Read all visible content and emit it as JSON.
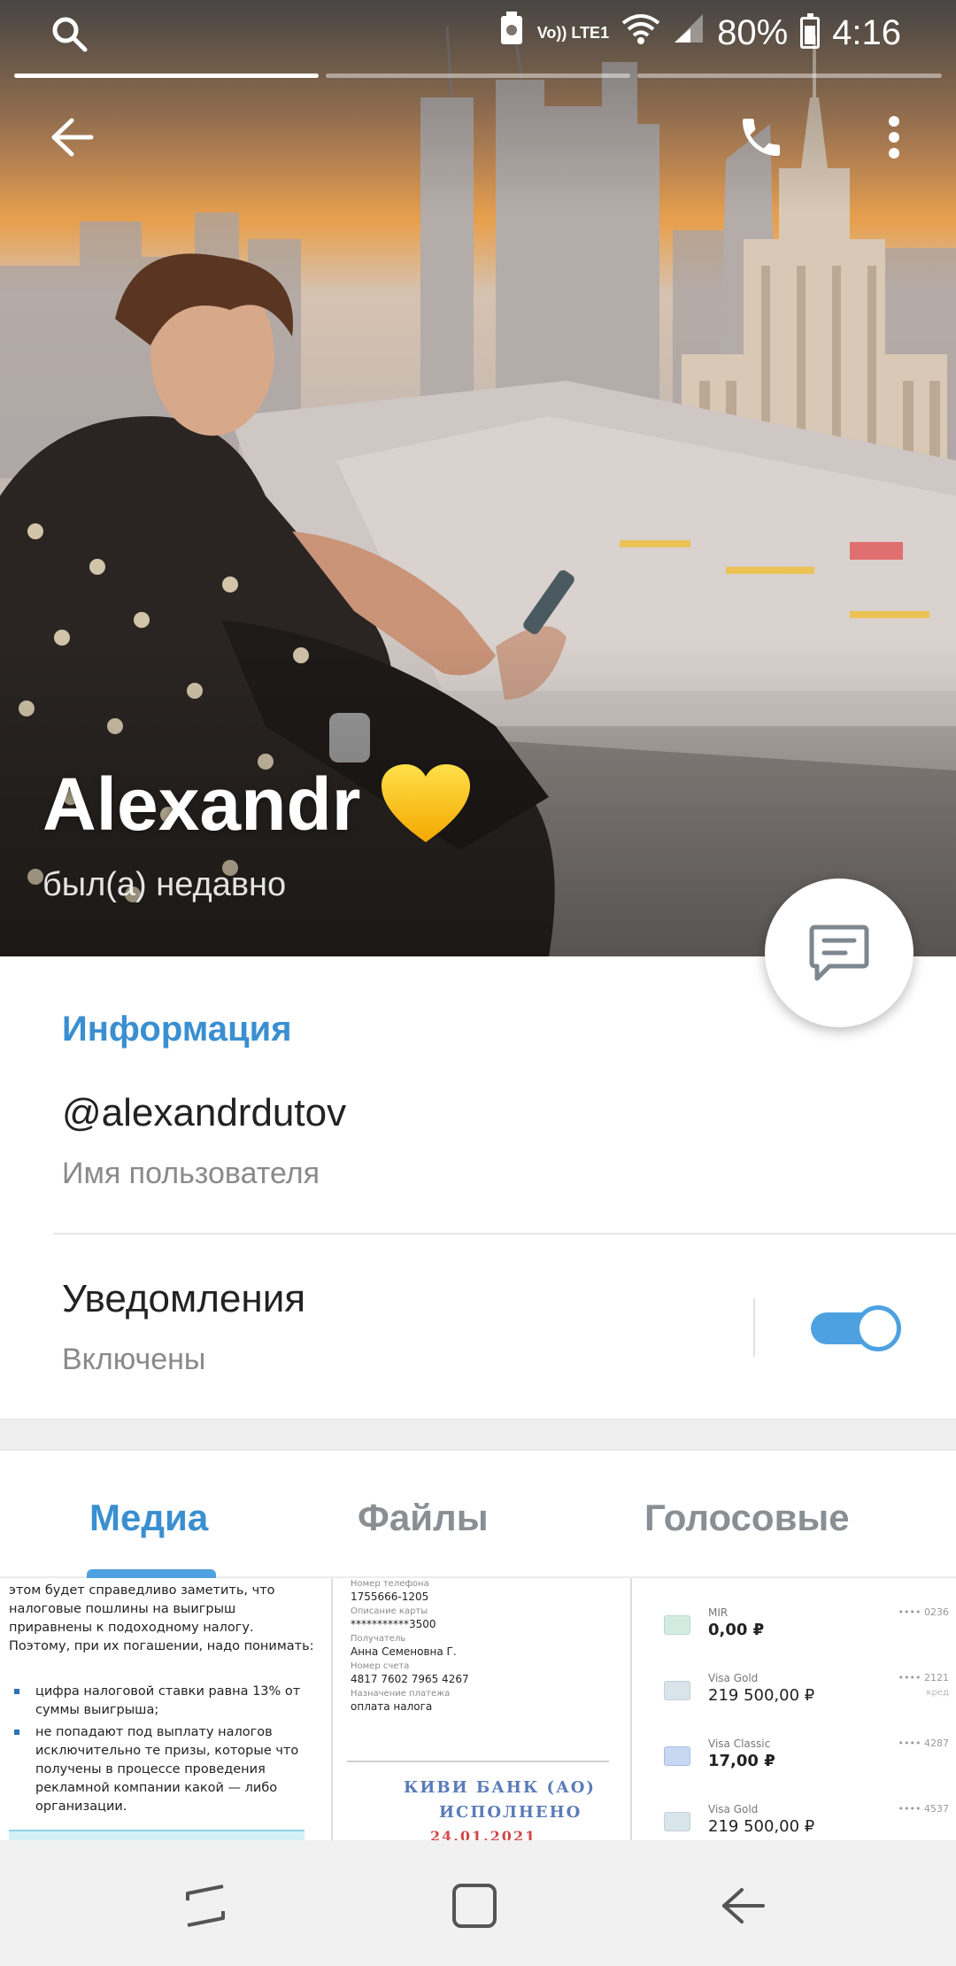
{
  "status_bar": {
    "network": "Vo)) LTE1",
    "battery": "80%",
    "time": "4:16"
  },
  "profile": {
    "name": "Alexandr",
    "name_emoji": "yellow-heart",
    "last_seen": "был(а) недавно"
  },
  "info": {
    "section_title": "Информация",
    "username": "@alexandrdutov",
    "username_label": "Имя пользователя",
    "notifications_title": "Уведомления",
    "notifications_status": "Включены",
    "notifications_enabled": true
  },
  "tabs": [
    {
      "label": "Медиа",
      "active": true
    },
    {
      "label": "Файлы",
      "active": false
    },
    {
      "label": "Голосовые",
      "active": false
    }
  ],
  "media": {
    "doc_paragraph": "этом будет справедливо заметить, что налоговые пошлины на выигрыш приравнены к подоходному налогу. Поэтому, при их погашении, надо понимать:",
    "doc_bullets": [
      "цифра налоговой ставки равна 13% от суммы выигрыша;",
      "не попадают под выплату налогов исключительно те призы, которые что получены в процессе проведения рекламной компании какой — либо организации."
    ],
    "receipt_rows": [
      {
        "label": "Номер телефона",
        "value": "1755666-1205"
      },
      {
        "label": "Описание карты",
        "value": "***********3500"
      },
      {
        "label": "Получатель",
        "value": "Анна Семеновна Г."
      },
      {
        "label": "Номер счета",
        "value": "4817 7602 7965 4267"
      },
      {
        "label": "Назначение платежа",
        "value": "оплата налога"
      }
    ],
    "receipt_stamp": [
      "КИВИ БАНК (АО)",
      "ИСПОЛНЕНО",
      "24.01.2021"
    ],
    "cards": [
      {
        "name": "MIR",
        "balance": "0,00 ₽",
        "number": "•••• 0236",
        "sub": ""
      },
      {
        "name": "Visa Gold",
        "balance": "219 500,00 ₽",
        "number": "•••• 2121",
        "sub": "кред"
      },
      {
        "name": "Visa Classic",
        "balance": "17,00 ₽",
        "number": "•••• 4287",
        "sub": ""
      },
      {
        "name": "Visa Gold",
        "balance": "219 500,00 ₽",
        "number": "•••• 4537",
        "sub": ""
      }
    ]
  },
  "colors": {
    "accent": "#3a8fd1",
    "toggle": "#4ea1e0"
  }
}
